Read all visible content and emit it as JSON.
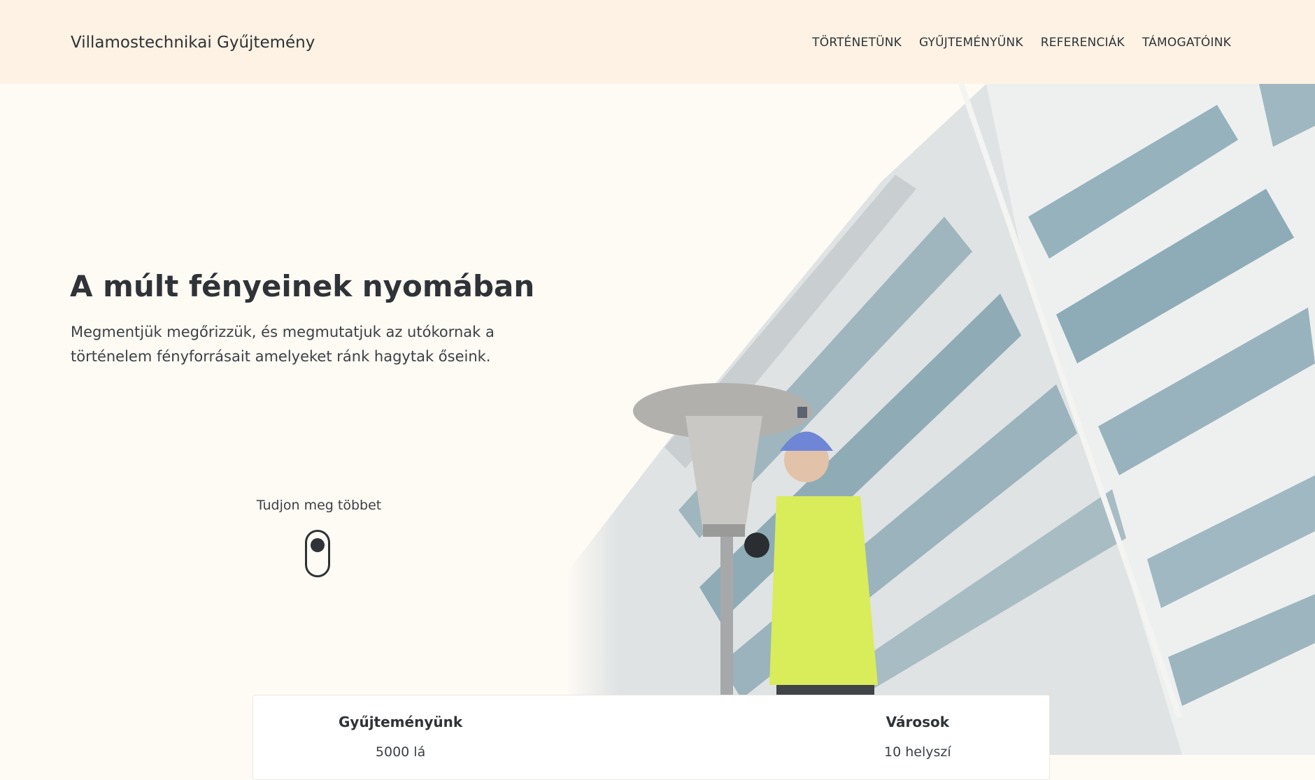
{
  "navbar": {
    "brand": "Villamostechnikai Gyűjtemény",
    "links": [
      "TÖRTÉNETÜNK",
      "GYŰJTEMÉNYÜNK",
      "REFERENCIÁK",
      "TÁMOGATÓINK"
    ]
  },
  "hero": {
    "title": "A múlt fényeinek nyomában",
    "subtitle": "Megmentjük megőrizzük, és megmutatjuk az utókornak a történelem fényforrásait amelyeket ránk hagytak őseink.",
    "cta_label": "Tudjon meg többet",
    "image": "photo of a worker in a hard hat and hi-vis jacket on a ladder next to a vintage street lamp in front of a multi-storey building"
  },
  "stats": [
    {
      "title": "Gyűjteményünk",
      "value": "5000 lá"
    },
    {
      "title": "Városok",
      "value": "10 helyszí"
    }
  ],
  "colors": {
    "navbar_bg": "#fdf2e4",
    "page_bg": "#fefaf4",
    "text": "#2f3337"
  }
}
